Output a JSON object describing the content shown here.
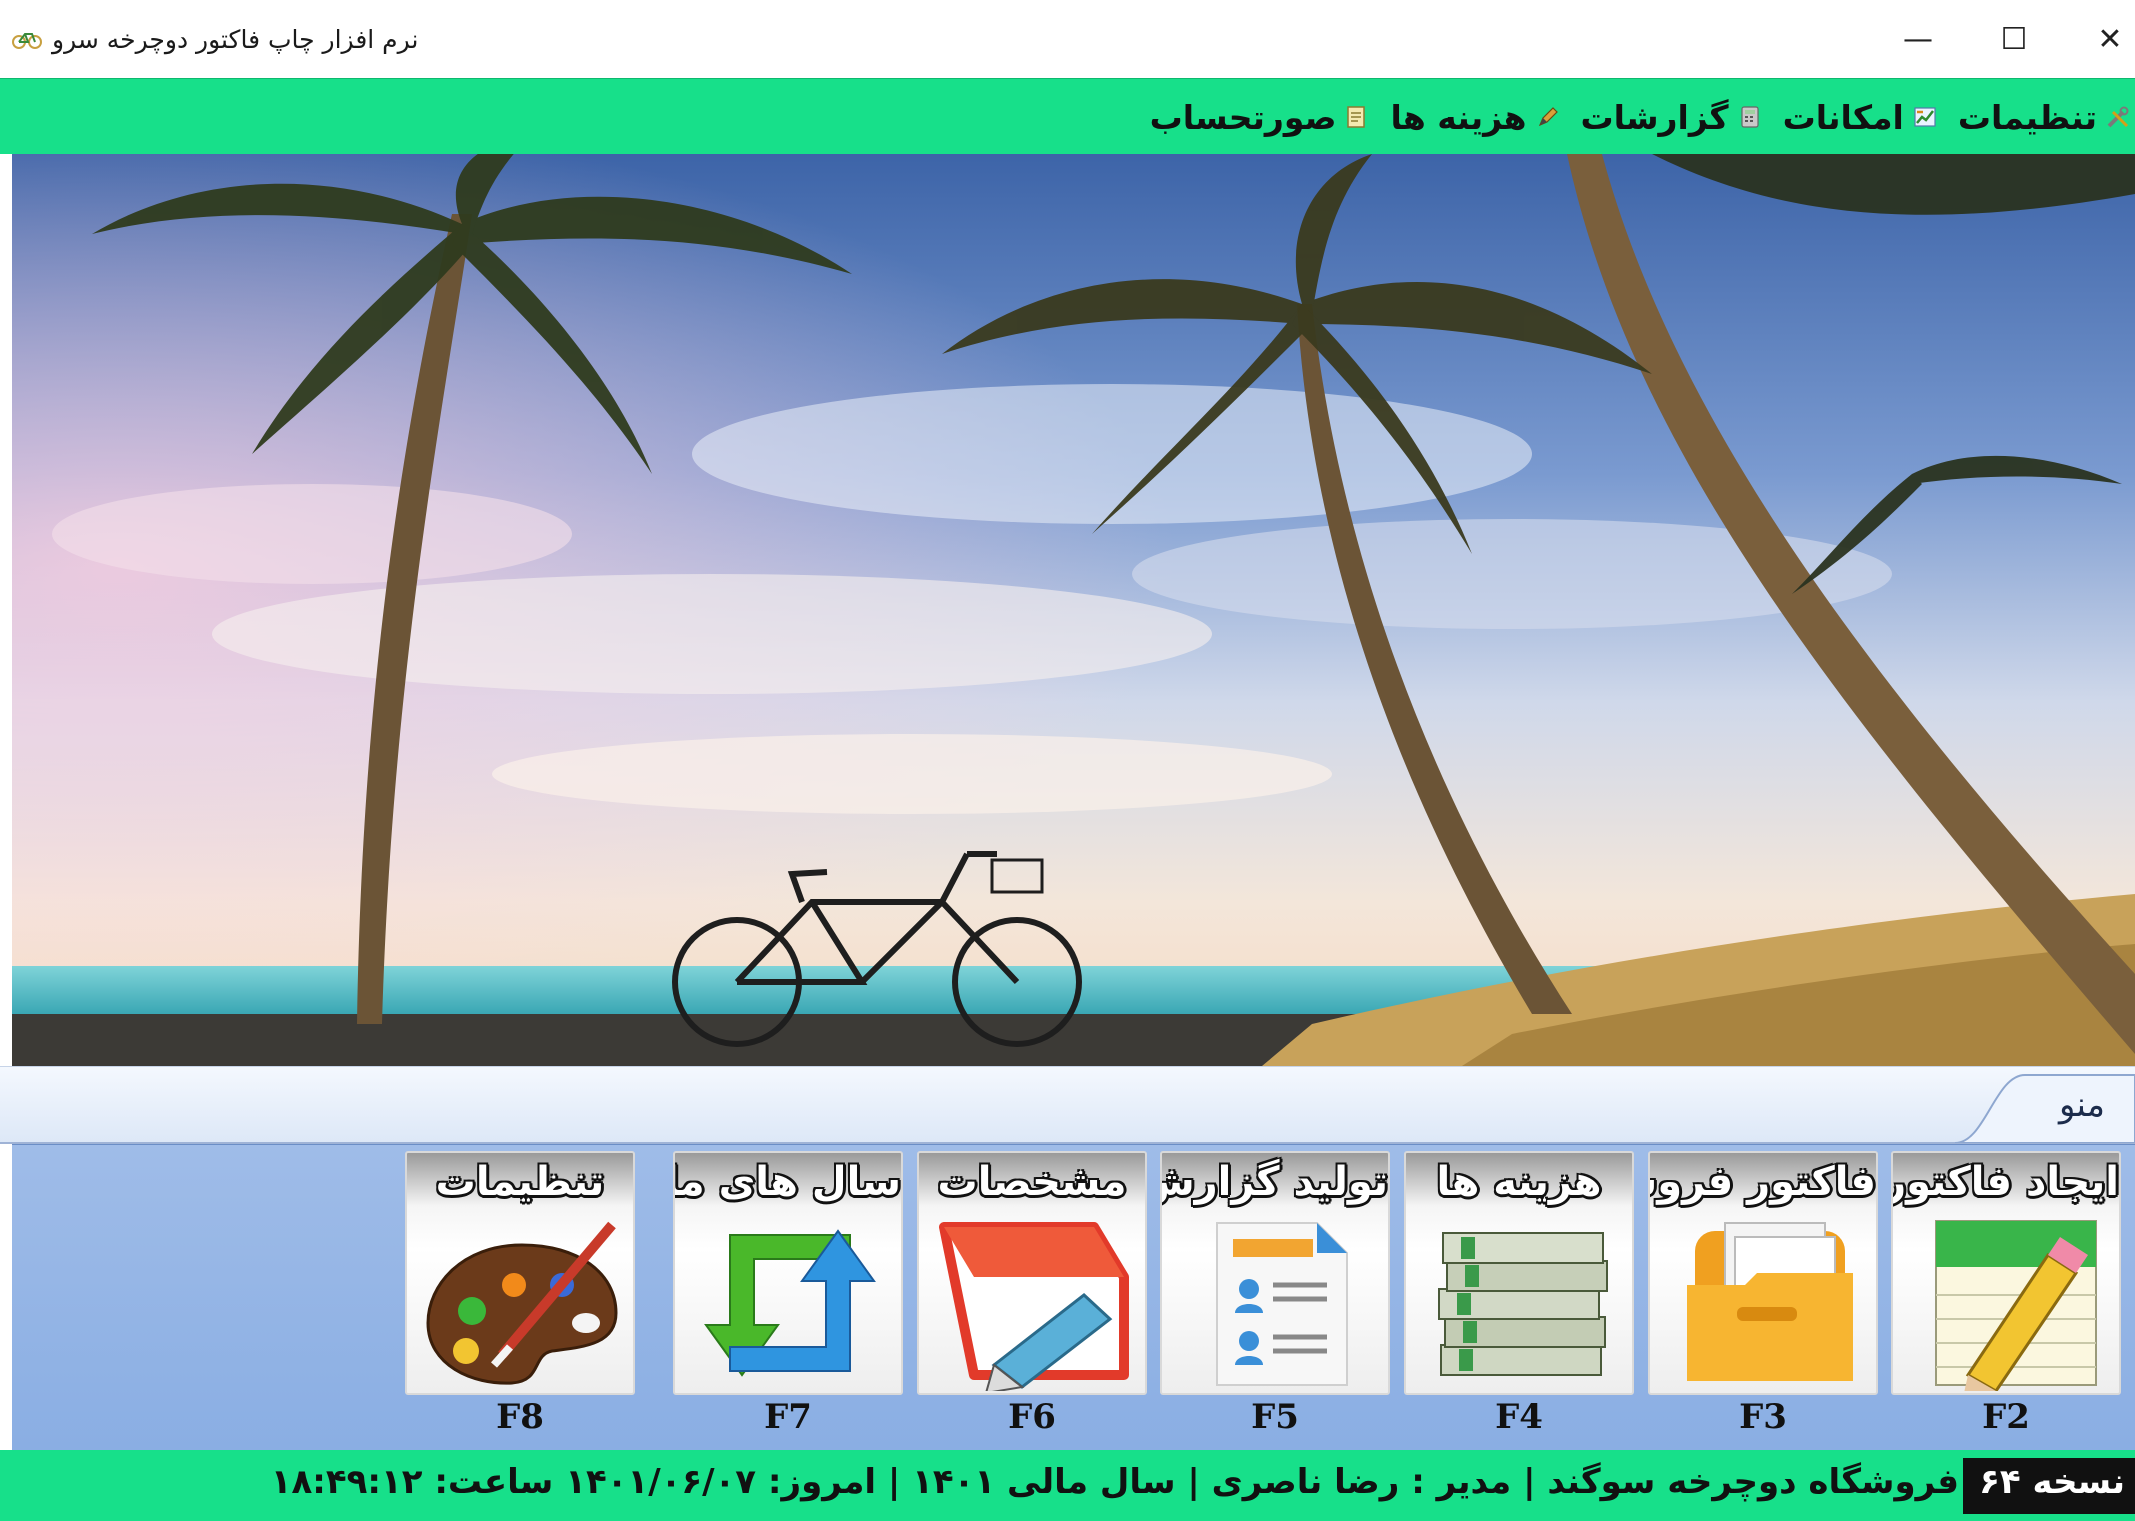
{
  "window": {
    "title": "نرم افزار چاپ فاکتور دوچرخه سرو",
    "minimize_glyph": "—",
    "maximize_glyph": "☐",
    "close_glyph": "✕"
  },
  "menu": {
    "items": [
      {
        "label": "صورتحساب",
        "icon": "invoice-icon"
      },
      {
        "label": "هزینه ها",
        "icon": "pen-icon"
      },
      {
        "label": "گزارشات",
        "icon": "calculator-icon"
      },
      {
        "label": "امکانات",
        "icon": "chart-icon"
      },
      {
        "label": "تنظیمات",
        "icon": "tools-icon"
      }
    ]
  },
  "tabs": {
    "active": "منو"
  },
  "ribbon": {
    "buttons": [
      {
        "label": "ایجاد فاکتور",
        "key": "F2",
        "icon": "notepad-pencil-icon"
      },
      {
        "label": "فاکتور فروش",
        "key": "F3",
        "icon": "folder-icon"
      },
      {
        "label": "هزینه ها",
        "key": "F4",
        "icon": "money-stack-icon"
      },
      {
        "label": "تولید گزارش",
        "key": "F5",
        "icon": "report-document-icon"
      },
      {
        "label": "مشخصات",
        "key": "F6",
        "icon": "edit-clipboard-icon"
      },
      {
        "label": "سال های مالی",
        "key": "F7",
        "icon": "refresh-arrows-icon"
      },
      {
        "label": "تنظیمات",
        "key": "F8",
        "icon": "palette-icon"
      }
    ]
  },
  "status": {
    "version": "نسخه ۶۴",
    "info": "فروشگاه دوچرخه سوگند  |  مدیر : رضا ناصری  |  سال مالی ۱۴۰۱  |  امروز: ۱۴۰۱/۰۶/۰۷  ساعت: ۱۸:۴۹:۱۲"
  },
  "colors": {
    "accent_green": "#17e08a",
    "ribbon_blue": "#8aaee3"
  }
}
